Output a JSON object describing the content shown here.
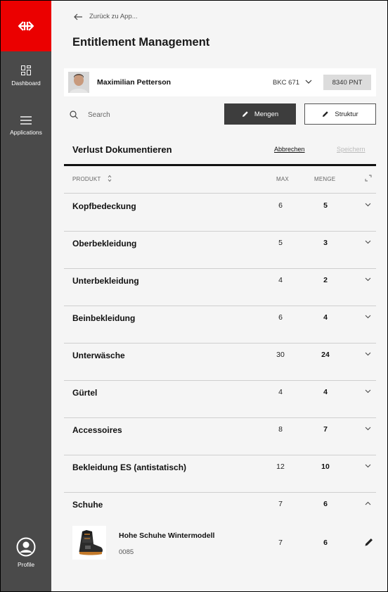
{
  "sidebar": {
    "items": [
      {
        "label": "Dashboard",
        "icon": "dashboard-icon"
      },
      {
        "label": "Applications",
        "icon": "menu-icon"
      }
    ],
    "profile_label": "Profile",
    "brand_color": "#eb0000"
  },
  "header": {
    "back_label": "Zurück zu App...",
    "title": "Entitlement Management"
  },
  "user": {
    "name": "Maximilian Petterson",
    "bkc": "BKC 671",
    "points": "8340 PNT"
  },
  "toolbar": {
    "search_placeholder": "Search",
    "mengen_label": "Mengen",
    "struktur_label": "Struktur"
  },
  "section": {
    "title": "Verlust Dokumentieren",
    "cancel_label": "Abbrechen",
    "save_label": "Speichern"
  },
  "table": {
    "headers": {
      "product": "PRODUKT",
      "max": "MAX",
      "menge": "MENGE"
    },
    "rows": [
      {
        "name": "Kopfbedeckung",
        "max": "6",
        "menge": "5"
      },
      {
        "name": "Oberbekleidung",
        "max": "5",
        "menge": "3"
      },
      {
        "name": "Unterbekleidung",
        "max": "4",
        "menge": "2"
      },
      {
        "name": "Beinbekleidung",
        "max": "6",
        "menge": "4"
      },
      {
        "name": "Unterwäsche",
        "max": "30",
        "menge": "24"
      },
      {
        "name": "Gürtel",
        "max": "4",
        "menge": "4"
      },
      {
        "name": "Accessoires",
        "max": "8",
        "menge": "7"
      },
      {
        "name": "Bekleidung ES (antistatisch)",
        "max": "12",
        "menge": "10"
      },
      {
        "name": "Schuhe",
        "max": "7",
        "menge": "6",
        "expanded": true
      }
    ],
    "expanded_item": {
      "name": "Hohe Schuhe Wintermodell",
      "code": "0085",
      "max": "7",
      "menge": "6"
    }
  }
}
